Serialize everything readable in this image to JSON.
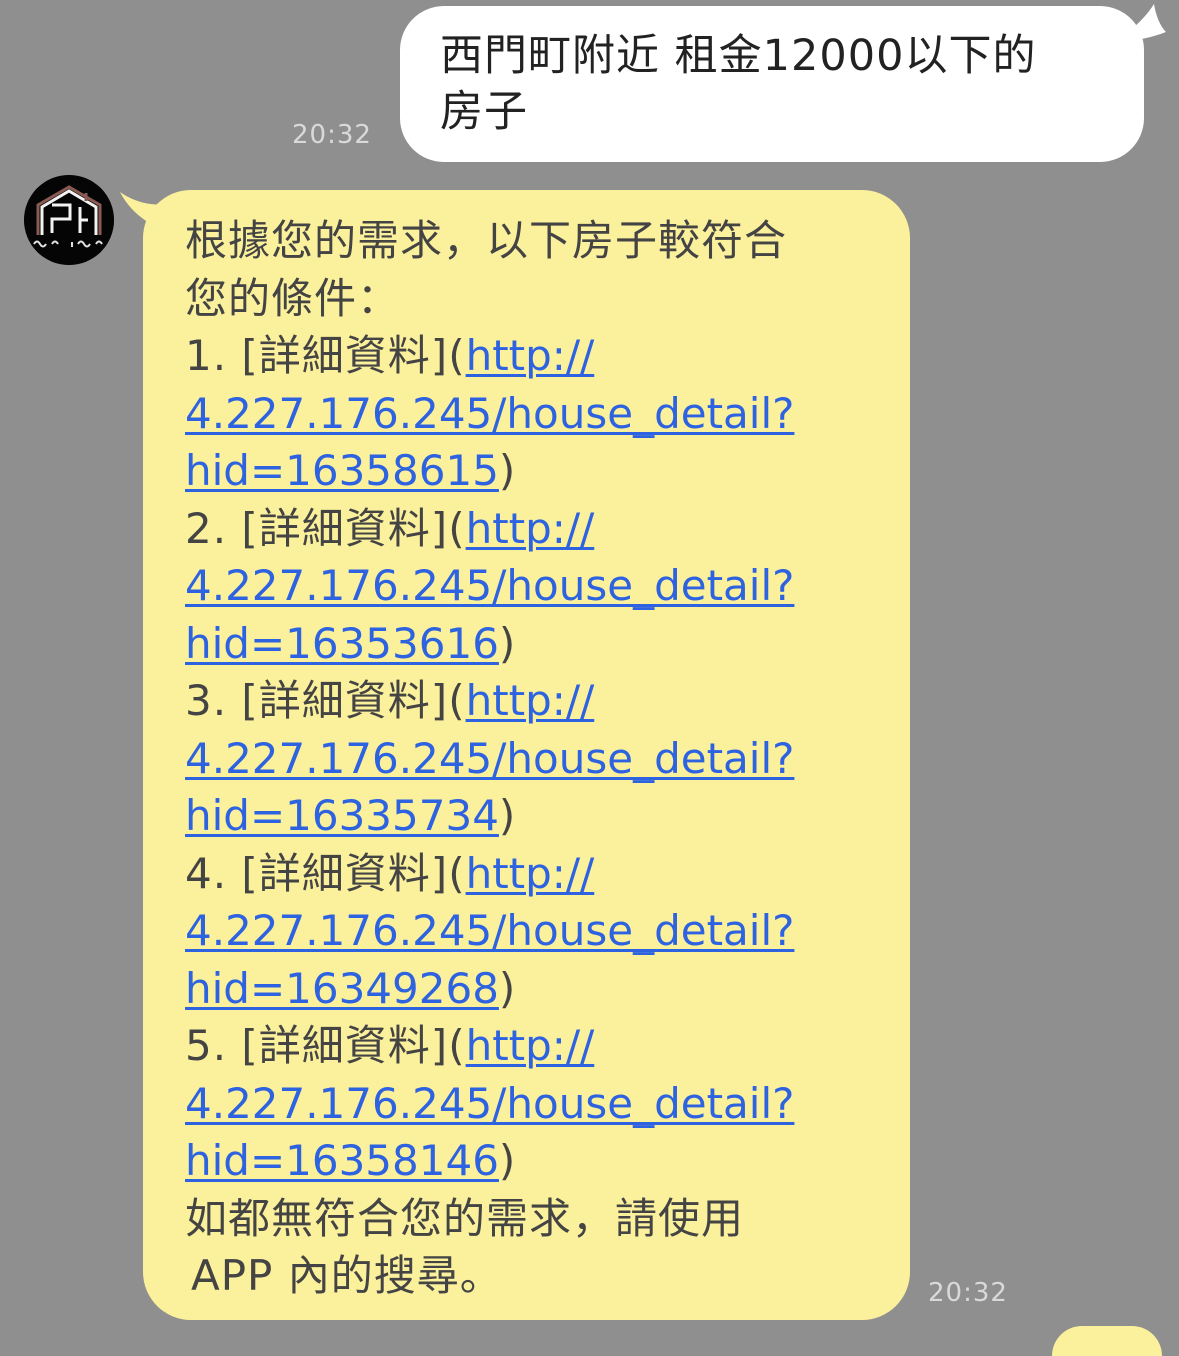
{
  "outgoing": {
    "text_line_1": "西門町附近 租金12000以下的",
    "text_line_2": "房子",
    "time": "20:32"
  },
  "incoming": {
    "sender_avatar": "house-logo-avatar",
    "intro_line_1": "根據您的需求，以下房子較符合",
    "intro_line_2": "您的條件：",
    "results": [
      {
        "prefix": "1. [詳細資料](",
        "url_line_1": "http://",
        "url_line_2": "4.227.176.245/house_detail?",
        "url_line_3": "hid=16358615",
        "suffix": ")"
      },
      {
        "prefix": "2. [詳細資料](",
        "url_line_1": "http://",
        "url_line_2": "4.227.176.245/house_detail?",
        "url_line_3": "hid=16353616",
        "suffix": ")"
      },
      {
        "prefix": "3. [詳細資料](",
        "url_line_1": "http://",
        "url_line_2": "4.227.176.245/house_detail?",
        "url_line_3": "hid=16335734",
        "suffix": ")"
      },
      {
        "prefix": "4. [詳細資料](",
        "url_line_1": "http://",
        "url_line_2": "4.227.176.245/house_detail?",
        "url_line_3": "hid=16349268",
        "suffix": ")"
      },
      {
        "prefix": "5. [詳細資料](",
        "url_line_1": "http://",
        "url_line_2": "4.227.176.245/house_detail?",
        "url_line_3": "hid=16358146",
        "suffix": ")"
      }
    ],
    "footer_line_1": "如都無符合您的需求，請使用",
    "footer_line_2": "APP 內的搜尋。",
    "time": "20:32"
  },
  "colors": {
    "background": "#8f8f8f",
    "outgoing_bubble": "#ffffff",
    "incoming_bubble": "#fbf09c",
    "link": "#2d62e0",
    "timestamp": "#d9d9d9"
  }
}
